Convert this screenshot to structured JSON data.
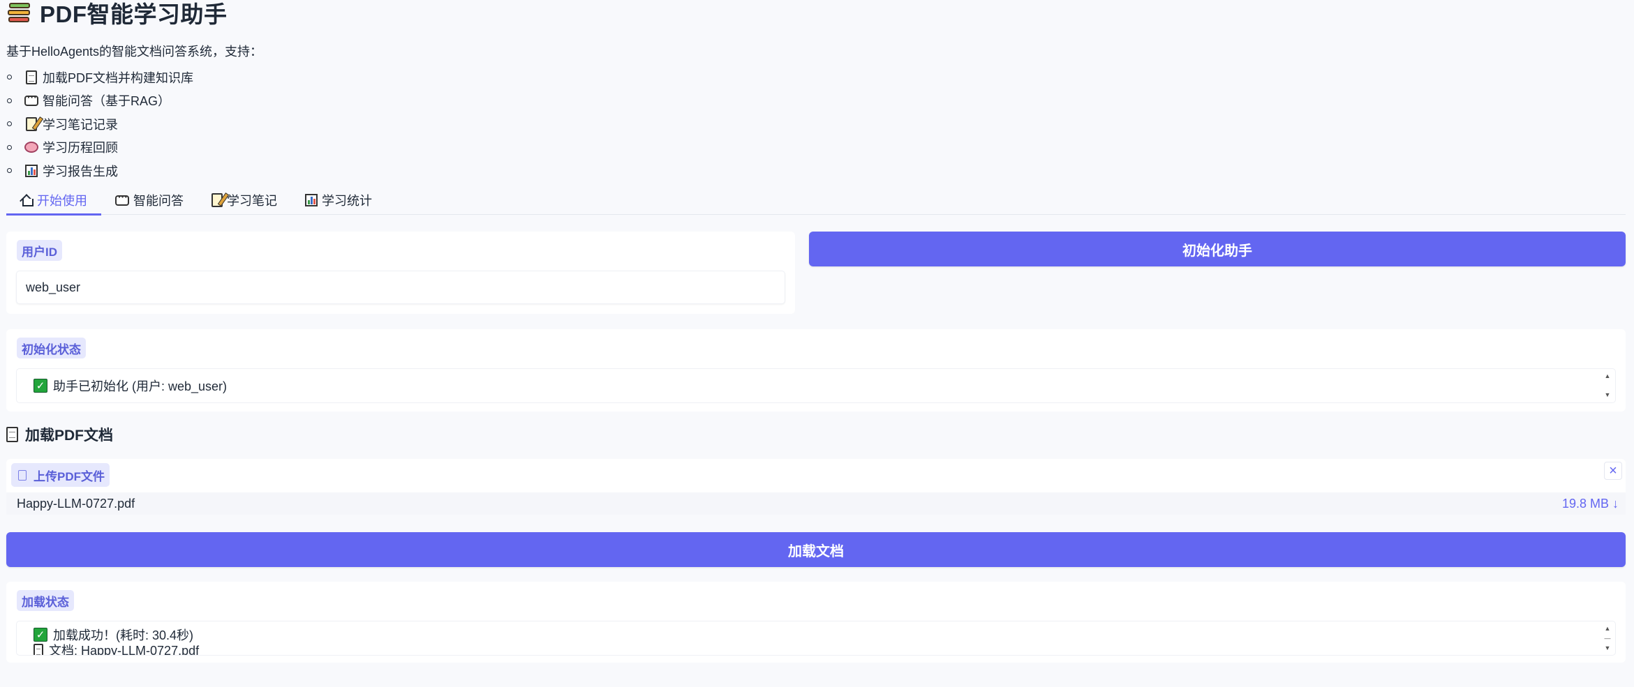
{
  "header": {
    "title": "PDF智能学习助手",
    "description": "基于HelloAgents的智能文档问答系统，支持：",
    "features": [
      {
        "icon": "document-icon",
        "label": "加载PDF文档并构建知识库"
      },
      {
        "icon": "speech-bubble-icon",
        "label": "智能问答（基于RAG）"
      },
      {
        "icon": "memo-icon",
        "label": "学习笔记记录"
      },
      {
        "icon": "brain-icon",
        "label": "学习历程回顾"
      },
      {
        "icon": "bar-chart-icon",
        "label": "学习报告生成"
      }
    ]
  },
  "tabs": [
    {
      "icon": "home-icon",
      "label": "开始使用",
      "active": true
    },
    {
      "icon": "speech-bubble-icon",
      "label": "智能问答",
      "active": false
    },
    {
      "icon": "memo-icon",
      "label": "学习笔记",
      "active": false
    },
    {
      "icon": "bar-chart-icon",
      "label": "学习统计",
      "active": false
    }
  ],
  "user_id": {
    "label": "用户ID",
    "value": "web_user"
  },
  "init_button": {
    "label": "初始化助手"
  },
  "init_status": {
    "label": "初始化状态",
    "text": "助手已初始化 (用户: web_user)"
  },
  "load_section": {
    "title": "加载PDF文档",
    "upload_label": "上传PDF文件",
    "file_name": "Happy-LLM-0727.pdf",
    "file_size": "19.8 MB ↓"
  },
  "load_button": {
    "label": "加载文档"
  },
  "load_status": {
    "label": "加载状态",
    "line1": "加载成功！(耗时: 30.4秒)",
    "line2": "文档: Happy-LLM-0727.pdf"
  },
  "colors": {
    "accent": "#6366f1",
    "chip_bg": "#e6e8fd",
    "success": "#22a53b",
    "background": "#f8f9fc"
  }
}
